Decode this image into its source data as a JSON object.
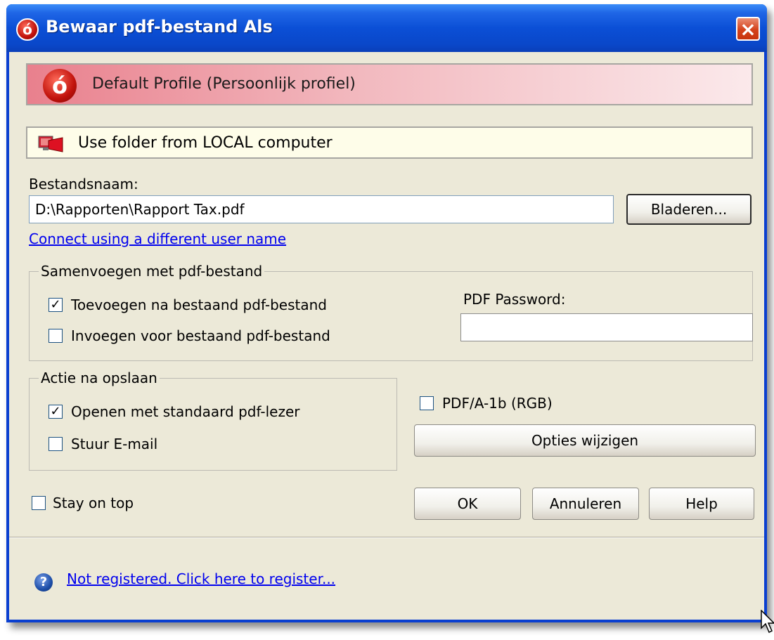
{
  "window": {
    "title": "Bewaar pdf-bestand Als",
    "close_icon": "×",
    "logo_glyph": "ó"
  },
  "profile_banner": {
    "text": "Default Profile (Persoonlijk profiel)"
  },
  "folder_banner": {
    "text": "Use folder from LOCAL computer"
  },
  "filename": {
    "label": "Bestandsnaam:",
    "value": "D:\\Rapporten\\Rapport Tax.pdf",
    "browse_label": "Bladeren..."
  },
  "connect_link": "Connect using a different user name",
  "merge_group": {
    "title": "Samenvoegen met pdf-bestand",
    "append_label": "Toevoegen na bestaand pdf-bestand",
    "append_checked": true,
    "insert_label": "Invoegen voor bestaand pdf-bestand",
    "insert_checked": false,
    "password_label": "PDF Password:",
    "password_value": ""
  },
  "after_save_group": {
    "title": "Actie na opslaan",
    "open_label": "Openen met standaard pdf-lezer",
    "open_checked": true,
    "email_label": "Stuur E-mail",
    "email_checked": false
  },
  "pdfa": {
    "label": "PDF/A-1b (RGB)",
    "checked": false
  },
  "options_button": "Opties wijzigen",
  "stay_on_top": {
    "label": "Stay on top",
    "checked": false
  },
  "buttons": {
    "ok": "OK",
    "cancel": "Annuleren",
    "help": "Help"
  },
  "register_link": "Not registered. Click here to register...",
  "help_glyph": "?",
  "check_glyph": "✓",
  "colors": {
    "titlebar": "#0b4fd6",
    "client_bg": "#ece9d8",
    "profile_banner": "#e9808d",
    "folder_banner": "#fefde9",
    "link": "#0000ee",
    "close_button": "#d4421b"
  }
}
